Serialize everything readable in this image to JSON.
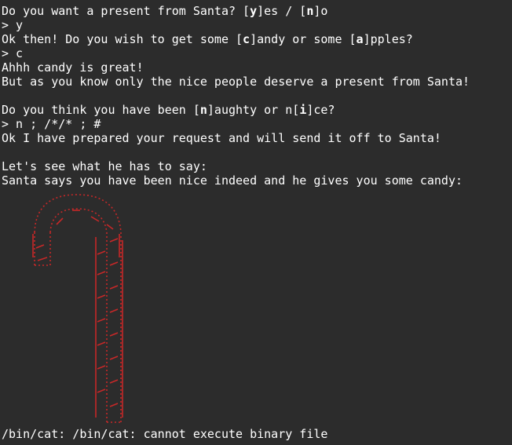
{
  "terminal": {
    "lines": [
      {
        "parts": [
          "Do you want a present from Santa? [",
          "y",
          "]es / [",
          "n",
          "]o"
        ]
      },
      {
        "parts": [
          "> y"
        ]
      },
      {
        "parts": [
          "Ok then! Do you wish to get some [",
          "c",
          "]andy or some [",
          "a",
          "]pples?"
        ]
      },
      {
        "parts": [
          "> c"
        ]
      },
      {
        "parts": [
          "Ahhh candy is great!"
        ]
      },
      {
        "parts": [
          "But as you know only the nice people deserve a present from Santa!"
        ]
      },
      {
        "parts": [
          ""
        ]
      },
      {
        "parts": [
          "Do you think you have been [",
          "n",
          "]aughty or n[",
          "i",
          "]ce?"
        ]
      },
      {
        "parts": [
          "> n ; /*/* ; #"
        ]
      },
      {
        "parts": [
          "Ok I have prepared your request and will send it off to Santa!"
        ]
      },
      {
        "parts": [
          ""
        ]
      },
      {
        "parts": [
          "Let's see what he has to say:"
        ]
      },
      {
        "parts": [
          "Santa says you have been nice indeed and he gives you some candy:"
        ]
      }
    ],
    "error": "/bin/cat: /bin/cat: cannot execute binary file"
  }
}
